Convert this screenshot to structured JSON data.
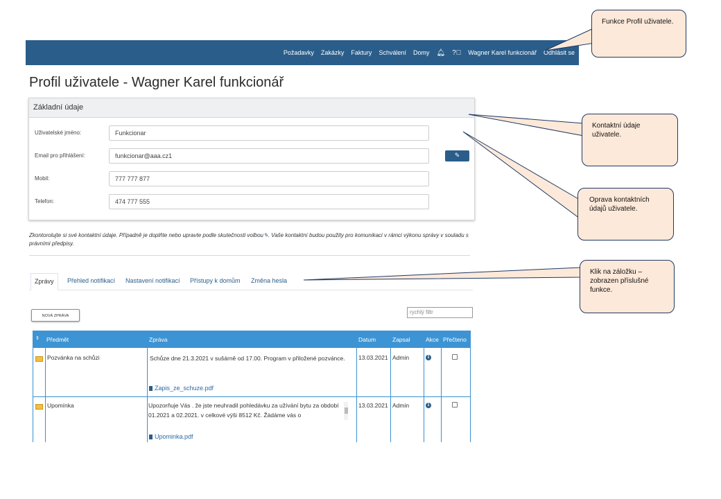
{
  "navbar": {
    "items": [
      "Požadavky",
      "Zakázky",
      "Faktury",
      "Schválení",
      "Domy"
    ],
    "bell_icon": "bell-icon",
    "help_icon": "help-icon",
    "user_name": "Wagner Karel funkcionář",
    "logout": "Odhlásit se",
    "color": "#2a5d8a"
  },
  "page_title": "Profil uživatele - Wagner Karel funkcionář",
  "basic_info": {
    "title": "Základní údaje",
    "fields": [
      {
        "label": "Uživatelské jméno:",
        "value": "Funkcionar"
      },
      {
        "label": "Email pro přihlášení:",
        "value": "funkcionar@aaa.cz1"
      },
      {
        "label": "Mobil:",
        "value": "777 777 877"
      },
      {
        "label": "Telefon:",
        "value": "474 777 555"
      }
    ],
    "edit_icon": "pencil-icon"
  },
  "info_text_a": "Zkontorolujte si své kontaktní údaje. Případně je doplňte nebo upravte podle skutečnosti volbou",
  "info_text_b": ". Vaše kontaktní budou použity pro komunikaci v rámci výkonu správy v souladu s právními předpisy.",
  "tabs": [
    "Zprávy",
    "Přehled notifikací",
    "Nastavení notifikací",
    "Přístupy k domům",
    "Změna hesla"
  ],
  "new_message_button": "NOVÁ ZPRÁVA",
  "quick_filter_placeholder": "rychlý filtr",
  "table": {
    "headers": [
      "Předmět",
      "Zpráva",
      "Datum",
      "Zapsal",
      "Akce",
      "Přečteno"
    ],
    "rows": [
      {
        "subject": "Pozvánka na schůzi",
        "message": "Schůze dne 21.3.2021 v sušárně od 17.00. Program v přiložené pozvánce.",
        "attachment": "Zapis_ze_schuze.pdf",
        "date": "13.03.2021",
        "author": "Admin"
      },
      {
        "subject": "Upomínka",
        "message": "Upozorňuje Vás . že jste neuhradil pohledávku za užívání bytu za období 01.2021 a 02.2021. v celkové výši 8512 Kč. Žádáme vás o",
        "attachment": "Upominka.pdf",
        "date": "13.03.2021",
        "author": "Admin"
      }
    ]
  },
  "callouts": {
    "profile": "Funkce Profil uživatele.",
    "contact": "Kontaktní údaje uživatele.",
    "edit": "Oprava kontaktních údajů uživatele.",
    "tabs": "Klik na záložku – zobrazen příslušné funkce."
  },
  "colors": {
    "accent": "#2a5d8a",
    "table_header": "#3d94d4",
    "callout_fill": "#fde9d9"
  }
}
